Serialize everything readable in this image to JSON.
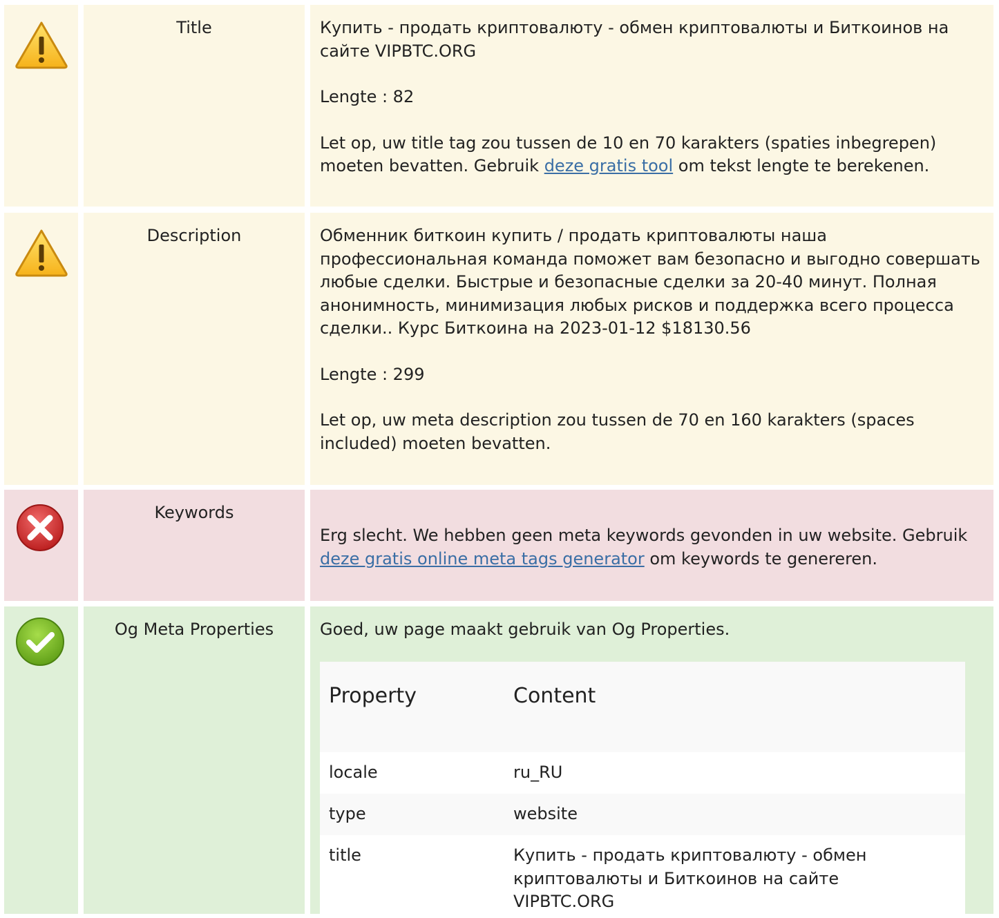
{
  "rows": {
    "title": {
      "label": "Title",
      "line1": "Купить - продать криптовалюту - обмен криптовалюты и Биткоинов на сайте VIPBTC.ORG",
      "length": "Lengte : 82",
      "advice_pre": "Let op, uw title tag zou tussen de 10 en 70 karakters (spaties inbegrepen) moeten bevatten. Gebruik ",
      "advice_link": "deze gratis tool",
      "advice_post": " om tekst lengte te berekenen."
    },
    "description": {
      "label": "Description",
      "text": "Обменник биткоин  купить / продать криптовалюты  наша профессиональная команда поможет вам безопасно и выгодно совершать любые сделки. Быстрые и безопасные сделки за 20-40 минут. Полная анонимность, минимизация любых рисков и поддержка всего процесса сделки.. Курс Биткоина на 2023-01-12 $18130.56",
      "length": "Lengte : 299",
      "advice": "Let op, uw meta description zou tussen de 70 en 160 karakters (spaces included) moeten bevatten."
    },
    "keywords": {
      "label": "Keywords",
      "text_pre": "Erg slecht. We hebben geen meta keywords gevonden in uw website. Gebruik ",
      "link": "deze gratis online meta tags generator",
      "text_post": " om keywords te genereren."
    },
    "og": {
      "label": "Og Meta Properties",
      "intro": "Goed, uw page maakt gebruik van Og Properties.",
      "table_header": {
        "property": "Property",
        "content": "Content"
      },
      "table_rows": [
        {
          "property": "locale",
          "content": "ru_RU"
        },
        {
          "property": "type",
          "content": "website"
        },
        {
          "property": "title",
          "content": "Купить - продать криптовалюту - обмен криптовалюты и Биткоинов на сайте VIPBTC.ORG"
        }
      ]
    }
  },
  "icons": {
    "warning": "warning-icon",
    "error": "error-icon",
    "success": "check-icon"
  },
  "colors": {
    "warning_bg": "#fcf7e4",
    "error_bg": "#f2dde0",
    "success_bg": "#dff0d8",
    "link": "#3a6ea5"
  }
}
